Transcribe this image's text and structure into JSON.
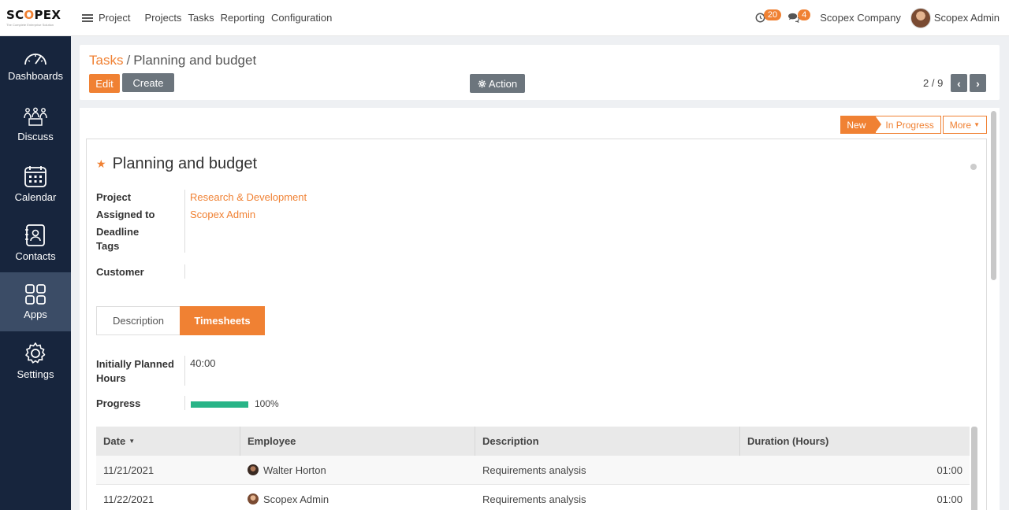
{
  "topbar": {
    "logo_text_pre": "SC",
    "logo_text_o": "O",
    "logo_text_post": "PEX",
    "logo_tagline": "The Complete Enterprise Solution",
    "app_name": "Project",
    "menu": [
      "Projects",
      "Tasks",
      "Reporting",
      "Configuration"
    ],
    "activity_count": "20",
    "message_count": "4",
    "company": "Scopex Company",
    "user": "Scopex Admin"
  },
  "sidebar": {
    "items": [
      {
        "label": "Dashboards",
        "icon": "speedometer-icon"
      },
      {
        "label": "Discuss",
        "icon": "people-discuss-icon"
      },
      {
        "label": "Calendar",
        "icon": "calendar-icon"
      },
      {
        "label": "Contacts",
        "icon": "contacts-book-icon"
      },
      {
        "label": "Apps",
        "icon": "apps-grid-icon",
        "active": true
      },
      {
        "label": "Settings",
        "icon": "gear-icon"
      }
    ]
  },
  "control": {
    "breadcrumb_parent": "Tasks",
    "breadcrumb_current": "Planning and budget",
    "edit_label": "Edit",
    "create_label": "Create",
    "action_label": "Action",
    "pager": "2 / 9"
  },
  "statusbar": {
    "stages": [
      "New",
      "In Progress"
    ],
    "more_label": "More",
    "active_stage": "New"
  },
  "task": {
    "title": "Planning and budget",
    "fields": {
      "project_label": "Project",
      "project_value": "Research & Development",
      "assigned_label": "Assigned to",
      "assigned_value": "Scopex Admin",
      "deadline_label": "Deadline",
      "tags_label": "Tags",
      "customer_label": "Customer"
    },
    "tabs": [
      "Description",
      "Timesheets"
    ],
    "active_tab": "Timesheets",
    "planned_hours_label": "Initially Planned Hours",
    "planned_hours_value": "40:00",
    "progress_label": "Progress",
    "progress_value": "100%",
    "progress_fraction": 1.0
  },
  "timesheets": {
    "columns": [
      "Date",
      "Employee",
      "Description",
      "Duration (Hours)"
    ],
    "rows": [
      {
        "date": "11/21/2021",
        "employee": "Walter Horton",
        "description": "Requirements analysis",
        "duration": "01:00"
      },
      {
        "date": "11/22/2021",
        "employee": "Scopex Admin",
        "description": "Requirements analysis",
        "duration": "01:00"
      }
    ]
  },
  "colors": {
    "accent": "#f08133",
    "sidebar": "#17253d",
    "progress": "#28b487"
  }
}
